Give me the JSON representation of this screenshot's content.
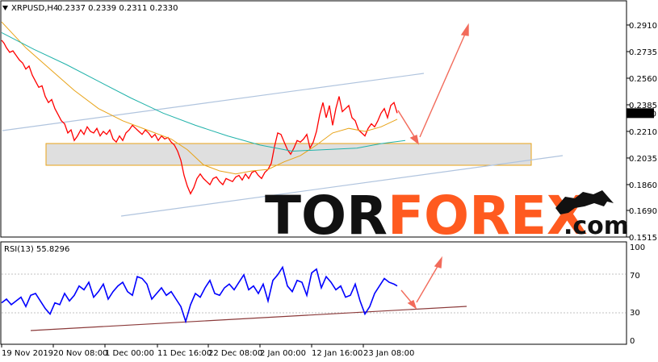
{
  "chart_data": [
    {
      "type": "line",
      "panel": "price",
      "header": {
        "symbol": "XRPUSD,H4",
        "ohlc": "0.2337 0.2339 0.2311 0.2330"
      },
      "ylim": [
        0.15,
        0.3
      ],
      "y_ticks": [
        "0.2910",
        "0.2735",
        "0.2560",
        "0.2385",
        "0.2210",
        "0.2035",
        "0.1860",
        "0.1690",
        "0.1515"
      ],
      "y_tick_values": [
        0.291,
        0.2735,
        0.256,
        0.2385,
        0.221,
        0.2035,
        0.186,
        0.169,
        0.1515
      ],
      "current_price": "0.2330",
      "current_price_value": 0.233,
      "series": [
        {
          "name": "",
          "role": "price",
          "color": "#ff0000",
          "x": [
            0,
            3,
            6,
            10,
            14,
            18,
            22,
            26,
            30,
            34,
            38,
            42,
            46,
            50,
            54,
            58,
            62,
            66,
            70,
            74,
            78,
            82,
            86,
            90,
            94,
            98,
            102,
            106,
            110,
            114,
            118,
            122,
            126,
            130,
            134,
            138,
            142,
            146,
            150,
            154,
            158,
            162,
            166,
            170,
            174,
            178,
            182,
            186,
            190,
            194,
            198,
            202,
            206,
            210,
            214,
            218,
            222,
            226,
            230,
            234,
            238,
            242,
            246,
            250,
            254,
            258,
            262,
            266,
            270,
            274,
            278,
            282,
            286,
            290,
            294,
            298,
            302,
            306,
            310,
            314,
            318,
            322,
            326,
            330,
            334,
            338,
            342,
            346,
            350,
            354,
            358,
            362,
            366,
            370,
            374,
            378,
            382,
            386,
            390,
            394,
            398,
            402,
            406,
            410,
            414,
            418,
            422,
            426,
            430,
            434,
            438,
            442,
            446,
            450,
            454,
            458,
            462,
            466,
            470,
            474,
            478,
            482,
            486,
            490
          ],
          "values": [
            0.281,
            0.279,
            0.276,
            0.273,
            0.274,
            0.271,
            0.268,
            0.266,
            0.262,
            0.264,
            0.258,
            0.254,
            0.25,
            0.251,
            0.244,
            0.24,
            0.242,
            0.236,
            0.232,
            0.228,
            0.226,
            0.22,
            0.222,
            0.215,
            0.218,
            0.222,
            0.219,
            0.224,
            0.221,
            0.22,
            0.223,
            0.218,
            0.221,
            0.219,
            0.222,
            0.216,
            0.214,
            0.218,
            0.215,
            0.22,
            0.222,
            0.225,
            0.223,
            0.221,
            0.219,
            0.222,
            0.22,
            0.217,
            0.219,
            0.215,
            0.218,
            0.216,
            0.217,
            0.214,
            0.212,
            0.208,
            0.202,
            0.192,
            0.185,
            0.18,
            0.184,
            0.19,
            0.193,
            0.19,
            0.188,
            0.186,
            0.19,
            0.191,
            0.188,
            0.186,
            0.19,
            0.189,
            0.188,
            0.191,
            0.192,
            0.189,
            0.193,
            0.19,
            0.194,
            0.195,
            0.192,
            0.19,
            0.194,
            0.196,
            0.2,
            0.211,
            0.22,
            0.219,
            0.214,
            0.209,
            0.206,
            0.21,
            0.215,
            0.214,
            0.216,
            0.219,
            0.21,
            0.214,
            0.221,
            0.232,
            0.24,
            0.23,
            0.238,
            0.225,
            0.236,
            0.244,
            0.234,
            0.236,
            0.238,
            0.23,
            0.228,
            0.222,
            0.22,
            0.218,
            0.223,
            0.226,
            0.224,
            0.228,
            0.233,
            0.236,
            0.23,
            0.238,
            0.24,
            0.233
          ]
        },
        {
          "name": "",
          "role": "fast-ma",
          "color": "#e8a317",
          "x": [
            0,
            30,
            60,
            90,
            120,
            150,
            180,
            210,
            230,
            250,
            270,
            290,
            310,
            330,
            350,
            370,
            390,
            410,
            430,
            450,
            470,
            490
          ],
          "values": [
            0.293,
            0.276,
            0.262,
            0.248,
            0.236,
            0.228,
            0.222,
            0.216,
            0.209,
            0.199,
            0.195,
            0.193,
            0.195,
            0.196,
            0.201,
            0.205,
            0.212,
            0.22,
            0.223,
            0.221,
            0.224,
            0.229
          ]
        },
        {
          "name": "",
          "role": "slow-ma",
          "color": "#20b2aa",
          "x": [
            0,
            40,
            80,
            120,
            160,
            200,
            240,
            280,
            320,
            360,
            400,
            440,
            470,
            500
          ],
          "values": [
            0.286,
            0.275,
            0.265,
            0.254,
            0.243,
            0.233,
            0.225,
            0.218,
            0.212,
            0.208,
            0.209,
            0.21,
            0.213,
            0.215
          ]
        }
      ]
    },
    {
      "type": "line",
      "panel": "indicator",
      "header": {
        "label": "RSI(13) 55.8296"
      },
      "ylim": [
        0,
        100
      ],
      "y_ticks": [
        "100",
        "70",
        "30",
        "0"
      ],
      "y_tick_values": [
        100,
        70,
        30,
        0
      ],
      "series": [
        {
          "name": "",
          "role": "rsi",
          "color": "#0000ff",
          "x": [
            0,
            6,
            12,
            18,
            24,
            30,
            36,
            42,
            48,
            54,
            60,
            66,
            72,
            78,
            84,
            90,
            96,
            102,
            108,
            114,
            120,
            126,
            132,
            138,
            144,
            150,
            156,
            162,
            168,
            174,
            180,
            186,
            192,
            198,
            204,
            210,
            216,
            222,
            228,
            234,
            240,
            246,
            252,
            258,
            264,
            270,
            276,
            282,
            288,
            294,
            300,
            306,
            312,
            318,
            324,
            330,
            336,
            342,
            348,
            354,
            360,
            366,
            372,
            378,
            384,
            390,
            396,
            402,
            408,
            414,
            420,
            426,
            432,
            438,
            444,
            450,
            456,
            462,
            468,
            474,
            480,
            486,
            490
          ],
          "values": [
            40,
            44,
            38,
            42,
            46,
            36,
            48,
            50,
            42,
            34,
            28,
            40,
            38,
            50,
            42,
            48,
            58,
            54,
            62,
            46,
            52,
            60,
            44,
            52,
            58,
            62,
            52,
            48,
            68,
            66,
            60,
            44,
            50,
            56,
            48,
            52,
            44,
            36,
            20,
            38,
            50,
            46,
            56,
            64,
            50,
            48,
            56,
            60,
            54,
            62,
            70,
            54,
            58,
            50,
            60,
            42,
            64,
            70,
            78,
            58,
            52,
            64,
            62,
            48,
            72,
            76,
            56,
            68,
            62,
            54,
            58,
            46,
            48,
            60,
            42,
            28,
            36,
            50,
            58,
            66,
            62,
            60,
            58
          ]
        }
      ]
    }
  ],
  "x_axis": {
    "ticks": [
      "19 Nov 2019",
      "20 Nov 08:00",
      "1 Dec 00:00",
      "11 Dec 16:00",
      "22 Dec 08:00",
      "2 Jan 00:00",
      "12 Jan 16:00",
      "23 Jan 08:00"
    ]
  },
  "watermark": {
    "part1": "TOR",
    "part2": "FOREX",
    "part3": ".com",
    "color1": "#111111",
    "color2": "#ff5a1f"
  },
  "colors": {
    "trendline": "#b0c4de",
    "rsi_trend": "#8b3a3a",
    "arrow": "#f26b5b",
    "zone_fill": "#d9d9d9",
    "zone_border": "#e8a317"
  }
}
